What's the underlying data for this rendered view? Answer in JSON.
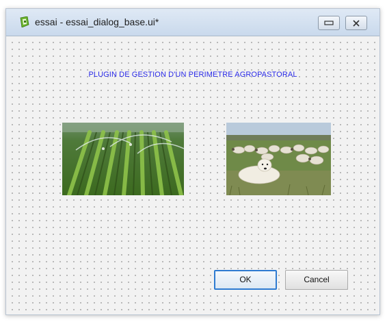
{
  "window": {
    "title": "essai - essai_dialog_base.ui*",
    "minimize_icon": "minimize-icon",
    "close_icon": "close-icon"
  },
  "dialog": {
    "heading": "PLUGIN DE GESTION D'UN PERIMETRE AGROPASTORAL",
    "heading_color": "#2a2ae8",
    "images": [
      {
        "subject": "irrigated crop field with sprinklers"
      },
      {
        "subject": "sheep flock with guard dog in a pasture"
      }
    ],
    "ok_label": "OK",
    "cancel_label": "Cancel",
    "accent_color": "#2e7bd1"
  }
}
